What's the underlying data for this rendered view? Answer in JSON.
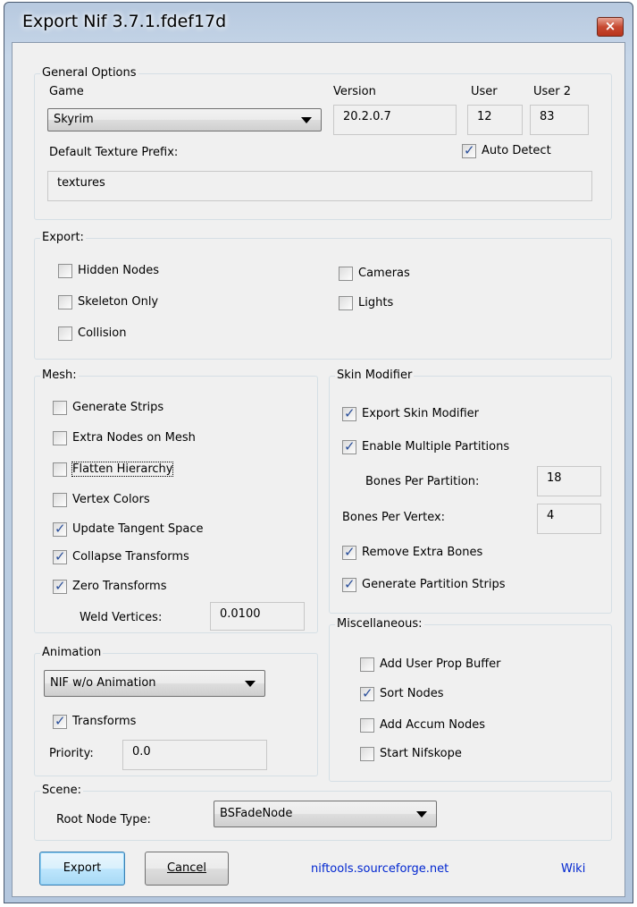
{
  "window": {
    "title": "Export Nif 3.7.1.fdef17d",
    "close_label": "×"
  },
  "general": {
    "legend": "General Options",
    "game_label": "Game",
    "game_value": "Skyrim",
    "version_label": "Version",
    "version_value": "20.2.0.7",
    "user_label": "User",
    "user_value": "12",
    "user2_label": "User 2",
    "user2_value": "83",
    "texture_prefix_label": "Default Texture Prefix:",
    "texture_prefix_value": "textures",
    "auto_detect": {
      "label": "Auto Detect",
      "checked": true
    }
  },
  "export": {
    "legend": "Export:",
    "items": [
      {
        "label": "Hidden Nodes",
        "checked": false
      },
      {
        "label": "Skeleton Only",
        "checked": false
      },
      {
        "label": "Collision",
        "checked": false
      },
      {
        "label": "Cameras",
        "checked": false
      },
      {
        "label": "Lights",
        "checked": false
      }
    ]
  },
  "mesh": {
    "legend": "Mesh:",
    "items": [
      {
        "label": "Generate Strips",
        "checked": false
      },
      {
        "label": "Extra Nodes on Mesh",
        "checked": false
      },
      {
        "label": "Flatten Hierarchy",
        "checked": false
      },
      {
        "label": "Vertex Colors",
        "checked": false
      },
      {
        "label": "Update Tangent Space",
        "checked": true
      },
      {
        "label": "Collapse Transforms",
        "checked": true
      },
      {
        "label": "Zero Transforms",
        "checked": true
      }
    ],
    "weld_label": "Weld Vertices:",
    "weld_value": "0.0100"
  },
  "skin": {
    "legend": "Skin Modifier",
    "export_skin": {
      "label": "Export Skin Modifier",
      "checked": true
    },
    "multi_partitions": {
      "label": "Enable Multiple Partitions",
      "checked": true
    },
    "bones_per_partition_label": "Bones Per Partition:",
    "bones_per_partition_value": "18",
    "bones_per_vertex_label": "Bones Per Vertex:",
    "bones_per_vertex_value": "4",
    "remove_extra": {
      "label": "Remove Extra Bones",
      "checked": true
    },
    "partition_strips": {
      "label": "Generate Partition Strips",
      "checked": true
    }
  },
  "animation": {
    "legend": "Animation",
    "mode_value": "NIF w/o Animation",
    "transforms": {
      "label": "Transforms",
      "checked": true
    },
    "priority_label": "Priority:",
    "priority_value": "0.0"
  },
  "misc": {
    "legend": "Miscellaneous:",
    "items": [
      {
        "label": "Add User Prop Buffer",
        "checked": false
      },
      {
        "label": "Sort Nodes",
        "checked": true
      },
      {
        "label": "Add Accum Nodes",
        "checked": false
      },
      {
        "label": "Start Nifskope",
        "checked": false
      }
    ]
  },
  "scene": {
    "legend": "Scene:",
    "root_label": "Root Node Type:",
    "root_value": "BSFadeNode"
  },
  "footer": {
    "export_label": "Export",
    "cancel_label": "Cancel",
    "site_link": "niftools.sourceforge.net",
    "wiki_link": "Wiki"
  }
}
